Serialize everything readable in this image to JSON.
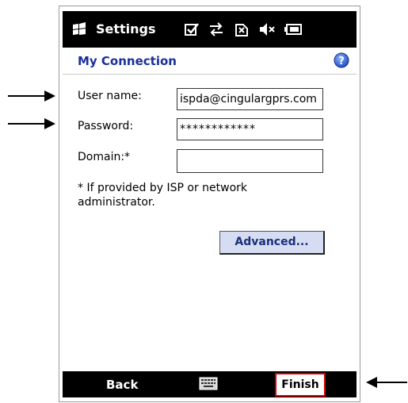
{
  "titlebar": {
    "app_title": "Settings",
    "logo_icon": "windows-flag-icon",
    "status_icons": [
      "checkbox-icon",
      "data-connection-icon",
      "no-sim-icon",
      "volume-muted-icon",
      "battery-icon"
    ]
  },
  "header": {
    "title": "My Connection",
    "help_icon": "help-icon"
  },
  "form": {
    "username_label": "User name:",
    "username_value": "ispda@cingulargprs.com",
    "password_label": "Password:",
    "password_value": "************",
    "domain_label": "Domain:*",
    "domain_value": ""
  },
  "note": "* If provided by ISP or network administrator.",
  "buttons": {
    "advanced_label": "Advanced...",
    "back_label": "Back",
    "finish_label": "Finish",
    "keyboard_icon": "keyboard-icon"
  },
  "colors": {
    "header_title": "#1a2f9a",
    "advanced_bg": "#d6dcf2",
    "finish_highlight": "#d10000",
    "bars": "#000000"
  }
}
